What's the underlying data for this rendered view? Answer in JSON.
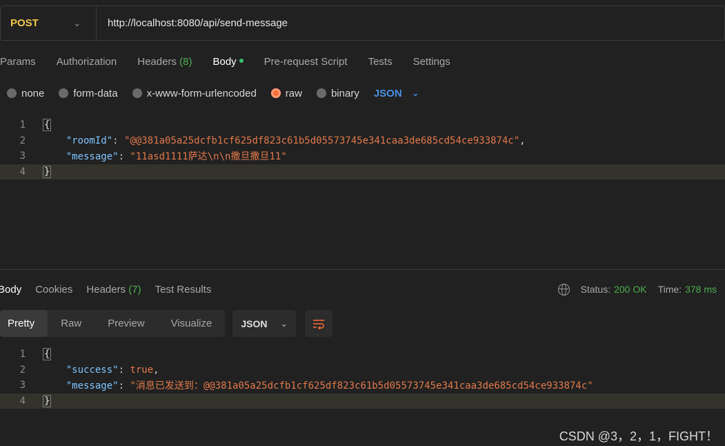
{
  "request": {
    "method": "POST",
    "url": "http://localhost:8080/api/send-message"
  },
  "request_tabs": {
    "params": "Params",
    "authorization": "Authorization",
    "headers": "Headers",
    "headers_count": "(8)",
    "body": "Body",
    "prerequest": "Pre-request Script",
    "tests": "Tests",
    "settings": "Settings"
  },
  "body_types": {
    "none": "none",
    "form_data": "form-data",
    "urlencoded": "x-www-form-urlencoded",
    "raw": "raw",
    "binary": "binary",
    "selected": "raw",
    "format": "JSON"
  },
  "request_body": {
    "line_numbers": [
      "1",
      "2",
      "3",
      "4"
    ],
    "open_brace": "{",
    "close_brace": "}",
    "key1": "\"roomId\"",
    "val1": "\"@@381a05a25dcfb1cf625df823c61b5d05573745e341caa3de685cd54ce933874c\"",
    "key2": "\"message\"",
    "val2": "\"11asd1111萨达\\n\\n撒旦撒旦11\""
  },
  "response_tabs": {
    "body": "Body",
    "cookies": "Cookies",
    "headers": "Headers",
    "headers_count": "(7)",
    "test_results": "Test Results"
  },
  "response_status": {
    "status_label": "Status:",
    "status_value": "200 OK",
    "time_label": "Time:",
    "time_value": "378 ms"
  },
  "response_view": {
    "pretty": "Pretty",
    "raw": "Raw",
    "preview": "Preview",
    "visualize": "Visualize",
    "format": "JSON"
  },
  "response_body": {
    "line_numbers": [
      "1",
      "2",
      "3",
      "4"
    ],
    "open_brace": "{",
    "close_brace": "}",
    "key1": "\"success\"",
    "val1": "true",
    "key2": "\"message\"",
    "val2": "\"消息已发送到：@@381a05a25dcfb1cf625df823c61b5d05573745e341caa3de685cd54ce933874c\""
  },
  "watermark": "CSDN @3，2，1，FIGHT！",
  "colors": {
    "method": "#f0c945",
    "accent_orange": "#ff6c37",
    "link_blue": "#4a90e2",
    "success_green": "#4caf50",
    "json_key": "#7ec4ff",
    "json_string": "#e2794a"
  }
}
